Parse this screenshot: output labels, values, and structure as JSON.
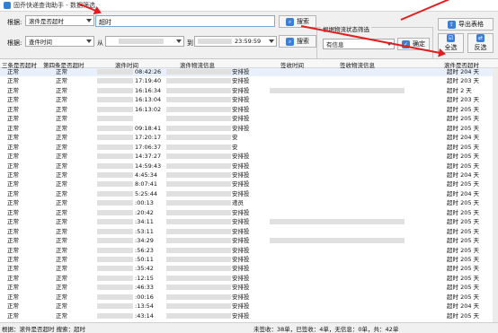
{
  "window": {
    "title": "固乔快递查询助手 - 数据筛选"
  },
  "toolbar": {
    "row1_label": "根据:",
    "row1_field": "滚件是否超时",
    "search_value": "超时",
    "search_button": "搜索",
    "row2_label": "根据:",
    "row2_field": "查件时间",
    "from_label": "从",
    "to_label": "到",
    "to_time": "23:59:59",
    "search_button2": "搜索",
    "status_group_title": "根据物流状态筛选",
    "status_value": "有信息",
    "confirm_button": "确定",
    "export_button": "导出表格",
    "select_all_button": "全选",
    "invert_button": "反选"
  },
  "grid": {
    "headers": [
      "三条是否超时",
      "第四条是否超时",
      "滚件时间",
      "滚件物流信息",
      "签收时间",
      "签收物流信息",
      "滚件是否超时"
    ],
    "rows": [
      {
        "c1": "正常",
        "c2": "正常",
        "time": "08:42:26",
        "sign": "安排投",
        "last": "超时 204 天"
      },
      {
        "c1": "正常",
        "c2": "正常",
        "time": "17:19:40",
        "sign": "安排投",
        "last": "超时 203 天"
      },
      {
        "c1": "正常",
        "c2": "正常",
        "time": "16:16:34",
        "sign": "安排投",
        "last": "超时 2 天"
      },
      {
        "c1": "正常",
        "c2": "正常",
        "time": "16:13:04",
        "sign": "安排投",
        "last": "超时 203 天"
      },
      {
        "c1": "正常",
        "c2": "正常",
        "time": "16:13:02",
        "sign": "安排投",
        "last": "超时 205 天"
      },
      {
        "c1": "正常",
        "c2": "正常",
        "time": "",
        "sign": "安排投",
        "last": "超时 205 天"
      },
      {
        "c1": "正常",
        "c2": "正常",
        "time": "09:18:41",
        "sign": "安排投",
        "last": "超时 205 天"
      },
      {
        "c1": "正常",
        "c2": "正常",
        "time": "17:20:17",
        "sign": "安",
        "last": "超时 204 天"
      },
      {
        "c1": "正常",
        "c2": "正常",
        "time": "17:06:37",
        "sign": "安",
        "last": "超时 205 天"
      },
      {
        "c1": "正常",
        "c2": "正常",
        "time": "14:37:27",
        "sign": "安排投",
        "last": "超时 205 天"
      },
      {
        "c1": "正常",
        "c2": "正常",
        "time": "14:59:43",
        "sign": "安排投",
        "last": "超时 205 天"
      },
      {
        "c1": "正常",
        "c2": "正常",
        "time": "4:45:34",
        "sign": "安排投",
        "last": "超时 204 天"
      },
      {
        "c1": "正常",
        "c2": "正常",
        "time": "8:07:41",
        "sign": "安排投",
        "last": "超时 205 天"
      },
      {
        "c1": "正常",
        "c2": "正常",
        "time": "5:25:44",
        "sign": "安排投",
        "last": "超时 204 天"
      },
      {
        "c1": "正常",
        "c2": "正常",
        "time": ":00:13",
        "sign": "递员",
        "last": "超时 205 天"
      },
      {
        "c1": "正常",
        "c2": "正常",
        "time": ":20:42",
        "sign": "安排投",
        "last": "超时 205 天"
      },
      {
        "c1": "正常",
        "c2": "正常",
        "time": ":34:11",
        "sign": "安排投",
        "last": "超时 205 天"
      },
      {
        "c1": "正常",
        "c2": "正常",
        "time": ":53:11",
        "sign": "安排投",
        "last": "超时 205 天"
      },
      {
        "c1": "正常",
        "c2": "正常",
        "time": ":34:29",
        "sign": "安排投",
        "last": "超时 205 天"
      },
      {
        "c1": "正常",
        "c2": "正常",
        "time": ":56:23",
        "sign": "安排投",
        "last": "超时 205 天"
      },
      {
        "c1": "正常",
        "c2": "正常",
        "time": ":50:11",
        "sign": "安排投",
        "last": "超时 205 天"
      },
      {
        "c1": "正常",
        "c2": "正常",
        "time": ":35:42",
        "sign": "安排投",
        "last": "超时 205 天"
      },
      {
        "c1": "正常",
        "c2": "正常",
        "time": ":12:15",
        "sign": "安排投",
        "last": "超时 205 天"
      },
      {
        "c1": "正常",
        "c2": "正常",
        "time": ":46:33",
        "sign": "安排投",
        "last": "超时 205 天"
      },
      {
        "c1": "正常",
        "c2": "正常",
        "time": ":00:16",
        "sign": "安排投",
        "last": "超时 205 天"
      },
      {
        "c1": "正常",
        "c2": "正常",
        "time": ":13:54",
        "sign": "安排投",
        "last": "超时 204 天"
      },
      {
        "c1": "正常",
        "c2": "正常",
        "time": ":43:14",
        "sign": "安排投",
        "last": "超时 205 天"
      }
    ]
  },
  "statusbar": {
    "left": "根据：滚件是否超时  搜索：超时",
    "right": "未签收：38单，已签收：4单，无信息：0单，共：42单"
  },
  "colors": {
    "accent": "#3b7ed3",
    "arrow": "#e02020"
  }
}
